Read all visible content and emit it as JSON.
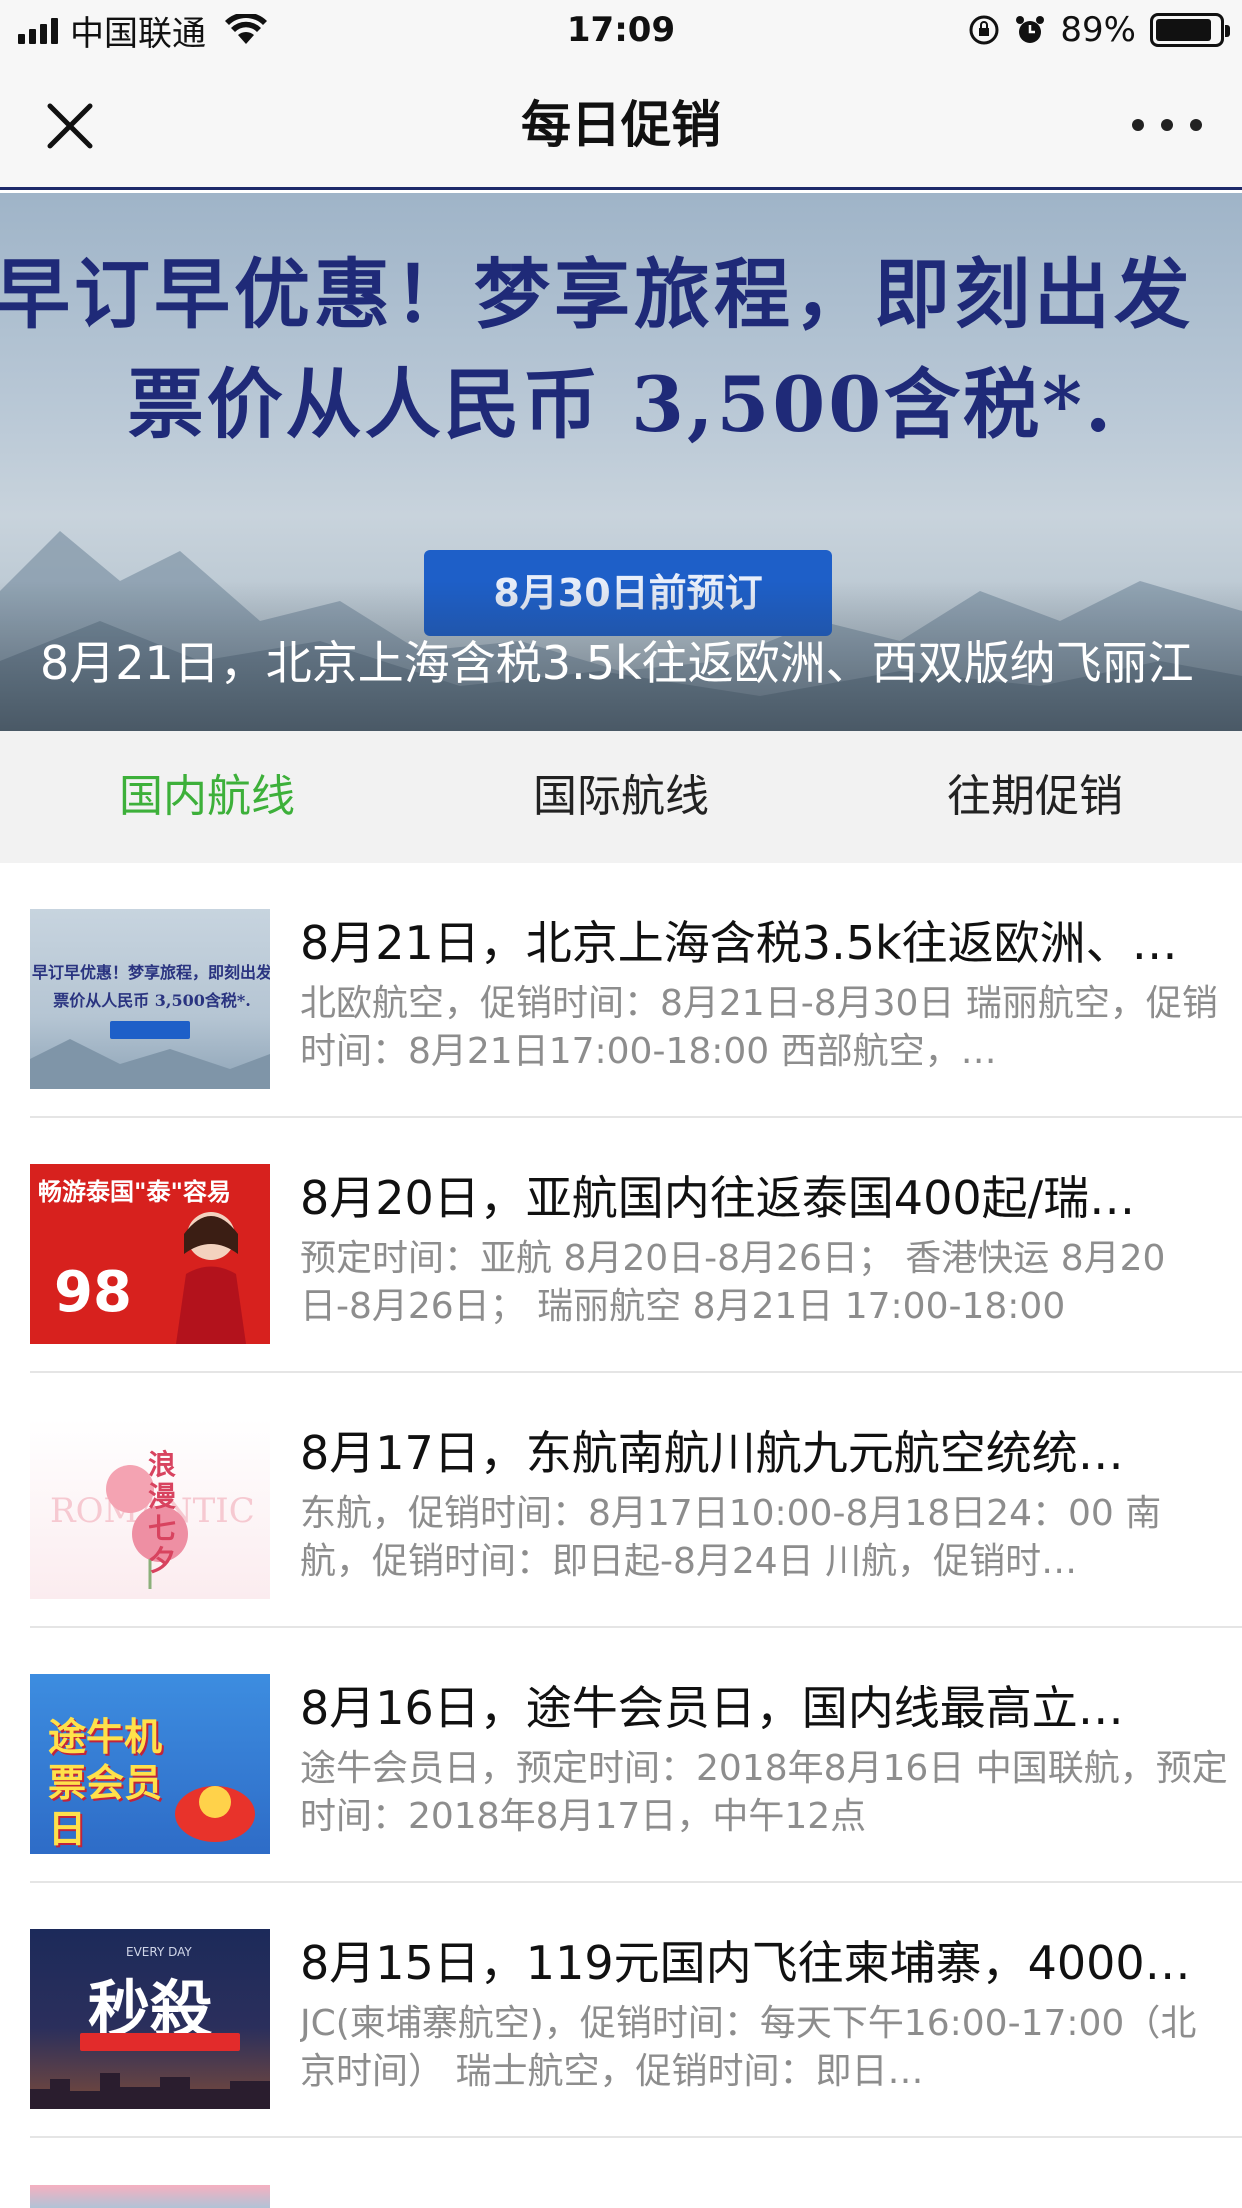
{
  "status_bar": {
    "carrier": "中国联通",
    "time": "17:09",
    "battery_percent": "89%",
    "battery_level": 0.89,
    "icons": [
      "signal-icon",
      "wifi-icon",
      "orientation-lock-icon",
      "alarm-icon",
      "battery-icon"
    ]
  },
  "nav": {
    "title": "每日促销",
    "close_icon": "close-icon",
    "more_icon": "more-icon"
  },
  "banner": {
    "headline": "早订早优惠！梦享旅程，即刻出发",
    "price_line": "票价从人民币 3,500含税*.",
    "cta_label": "8月30日前预订",
    "caption": "8月21日，北京上海含税3.5k往返欧洲、西双版纳飞丽江"
  },
  "tabs": [
    {
      "label": "国内航线",
      "active": true
    },
    {
      "label": "国际航线",
      "active": false
    },
    {
      "label": "往期促销",
      "active": false
    }
  ],
  "colors": {
    "accent_green": "#3db03a",
    "banner_text": "#1f2a78",
    "desc_gray": "#8d8d8d"
  },
  "items": [
    {
      "title": "8月21日，北京上海含税3.5k往返欧洲、…",
      "desc": "北欧航空，促销时间：8月21日-8月30日 瑞丽航空，促销时间：8月21日17:00-18:00 西部航空，…",
      "thumb": {
        "line1": "早订早优惠！梦享旅程，即刻出发",
        "line2": "票价从人民币 3,500含税*."
      }
    },
    {
      "title": "8月20日，亚航国内往返泰国400起/瑞…",
      "desc": "预定时间：亚航 8月20日-8月26日； 香港快运 8月20日-8月26日； 瑞丽航空 8月21日 17:00-18:00",
      "thumb": {
        "headline": "畅游泰国\"泰\"容易",
        "price": "98"
      }
    },
    {
      "title": "8月17日，东航南航川航九元航空统统…",
      "desc": "东航，促销时间：8月17日10:00-8月18日24：00 南航，促销时间：即日起-8月24日 川航，促销时…",
      "thumb": {
        "headline": "浪漫七夕",
        "bg_word": "ROMANTIC"
      }
    },
    {
      "title": "8月16日，途牛会员日，国内线最高立…",
      "desc": "途牛会员日，预定时间：2018年8月16日 中国联航，预定时间：2018年8月17日，中午12点",
      "thumb": {
        "headline": "途牛机票会员日"
      }
    },
    {
      "title": "8月15日，119元国内飞往柬埔寨，4000…",
      "desc": "JC(柬埔寨航空)，促销时间：每天下午16:00-17:00（北京时间） 瑞士航空，促销时间：即日…",
      "thumb": {
        "headline": "秒殺",
        "sub": "EVERY DAY"
      }
    }
  ]
}
